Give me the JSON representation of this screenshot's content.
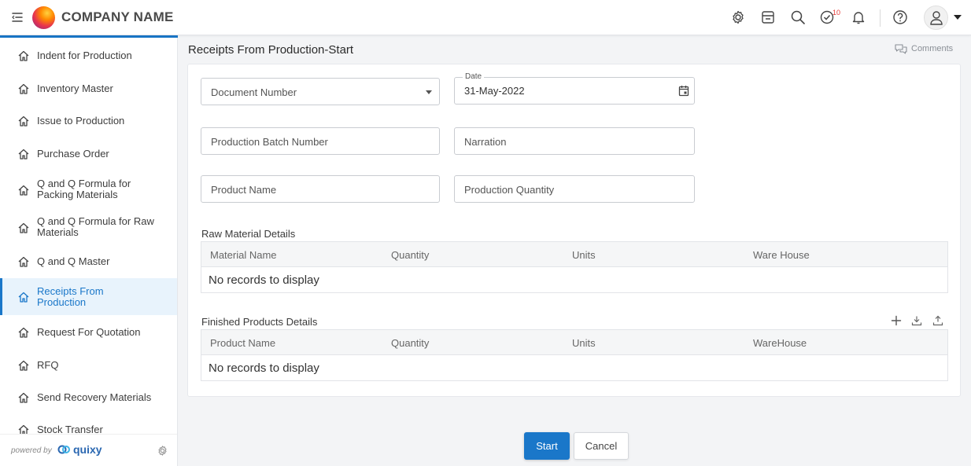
{
  "header": {
    "company_name": "COMPANY NAME",
    "notification_badge": "10",
    "icons": [
      "menu-toggle-icon",
      "gear-icon",
      "store-icon",
      "search-icon",
      "tasks-check-icon",
      "bell-icon",
      "help-icon",
      "user-icon",
      "chevron-down-icon"
    ]
  },
  "sidebar": {
    "items": [
      {
        "label": "Indent for Production",
        "active": false
      },
      {
        "label": "Inventory Master",
        "active": false
      },
      {
        "label": "Issue to Production",
        "active": false
      },
      {
        "label": "Purchase Order",
        "active": false
      },
      {
        "label": "Q and Q Formula for Packing Materials",
        "active": false
      },
      {
        "label": "Q and Q Formula for Raw Materials",
        "active": false
      },
      {
        "label": "Q and Q Master",
        "active": false
      },
      {
        "label": "Receipts From Production",
        "active": true
      },
      {
        "label": "Request For Quotation",
        "active": false
      },
      {
        "label": "RFQ",
        "active": false
      },
      {
        "label": "Send Recovery Materials",
        "active": false
      },
      {
        "label": "Stock Transfer",
        "active": false
      }
    ],
    "footer": {
      "powered_by": "powered by",
      "brand": "quixy"
    }
  },
  "page": {
    "title": "Receipts From Production-Start",
    "comments_label": "Comments"
  },
  "form": {
    "document_number": {
      "placeholder": "Document Number"
    },
    "date": {
      "label": "Date",
      "value": "31-May-2022"
    },
    "production_batch_number": {
      "placeholder": "Production Batch Number"
    },
    "narration": {
      "placeholder": "Narration"
    },
    "product_name": {
      "placeholder": "Product Name"
    },
    "production_quantity": {
      "placeholder": "Production Quantity"
    }
  },
  "raw_material": {
    "title": "Raw Material Details",
    "columns": [
      "Material Name",
      "Quantity",
      "Units",
      "Ware House"
    ],
    "empty_text": "No records to display"
  },
  "finished_products": {
    "title": "Finished Products Details",
    "columns": [
      "Product Name",
      "Quantity",
      "Units",
      "WareHouse"
    ],
    "empty_text": "No records to display",
    "tools": [
      "add-icon",
      "download-icon",
      "upload-icon"
    ]
  },
  "actions": {
    "start_label": "Start",
    "cancel_label": "Cancel"
  },
  "colors": {
    "accent": "#1a77c9",
    "badge": "#e53935",
    "active_bg": "#e8f3fc"
  }
}
